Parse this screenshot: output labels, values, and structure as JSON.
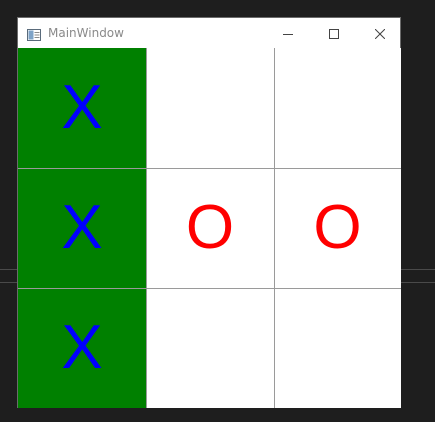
{
  "window": {
    "title": "MainWindow",
    "controls": {
      "minimize_icon": "minimize-icon",
      "maximize_icon": "maximize-icon",
      "close_icon": "close-icon"
    }
  },
  "board": {
    "cells": [
      {
        "row": 0,
        "col": 0,
        "mark": "X",
        "mark_color": "#0000ff",
        "bg": "#008000"
      },
      {
        "row": 0,
        "col": 1,
        "mark": "",
        "mark_color": "#ff0000",
        "bg": "#ffffff"
      },
      {
        "row": 0,
        "col": 2,
        "mark": "",
        "mark_color": "#ff0000",
        "bg": "#ffffff"
      },
      {
        "row": 1,
        "col": 0,
        "mark": "X",
        "mark_color": "#0000ff",
        "bg": "#008000"
      },
      {
        "row": 1,
        "col": 1,
        "mark": "O",
        "mark_color": "#ff0000",
        "bg": "#ffffff"
      },
      {
        "row": 1,
        "col": 2,
        "mark": "O",
        "mark_color": "#ff0000",
        "bg": "#ffffff"
      },
      {
        "row": 2,
        "col": 0,
        "mark": "X",
        "mark_color": "#0000ff",
        "bg": "#008000"
      },
      {
        "row": 2,
        "col": 1,
        "mark": "",
        "mark_color": "#ff0000",
        "bg": "#ffffff"
      },
      {
        "row": 2,
        "col": 2,
        "mark": "",
        "mark_color": "#ff0000",
        "bg": "#ffffff"
      }
    ]
  },
  "colors": {
    "x_color": "#0000ff",
    "o_color": "#ff0000",
    "win_highlight": "#008000",
    "grid_line": "#9a9a9a",
    "desktop": "#1e1e1e"
  }
}
